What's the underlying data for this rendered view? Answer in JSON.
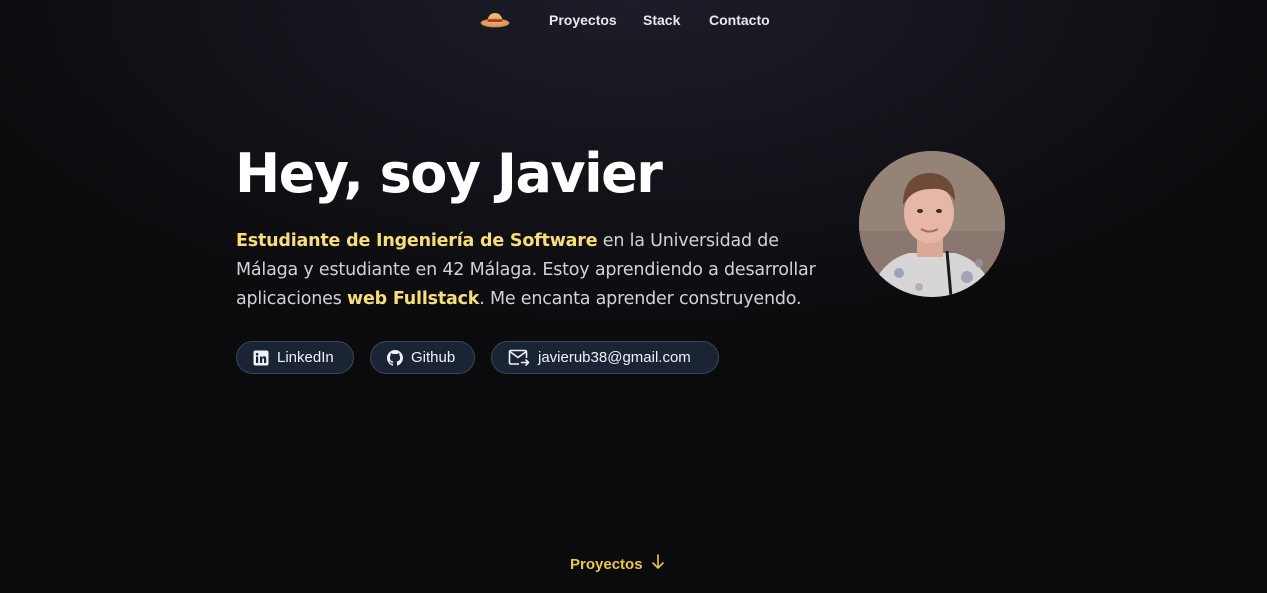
{
  "nav": {
    "logo_icon": "straw-hat-icon",
    "links": [
      "Proyectos",
      "Stack",
      "Contacto"
    ]
  },
  "hero": {
    "title": "Hey, soy Javier",
    "desc": {
      "part1_highlight": "Estudiante de Ingeniería de Software",
      "part2": " en la Universidad de Málaga y estudiante en 42 Málaga. Estoy aprendiendo a desarrollar aplicaciones ",
      "part3_highlight": "web Fullstack",
      "part4": ". Me encanta aprender construyendo."
    },
    "avatar_alt": "profile-photo"
  },
  "buttons": {
    "linkedin": "LinkedIn",
    "github": "Github",
    "email": "javierub38@gmail.com"
  },
  "scroll_link": {
    "label": "Proyectos",
    "icon": "arrow-down-icon"
  },
  "colors": {
    "background": "#0b0a0c",
    "highlight": "#f6df7a",
    "accent_link": "#e8c846",
    "button_bg": "#1b2434",
    "button_border": "#3b4659"
  }
}
